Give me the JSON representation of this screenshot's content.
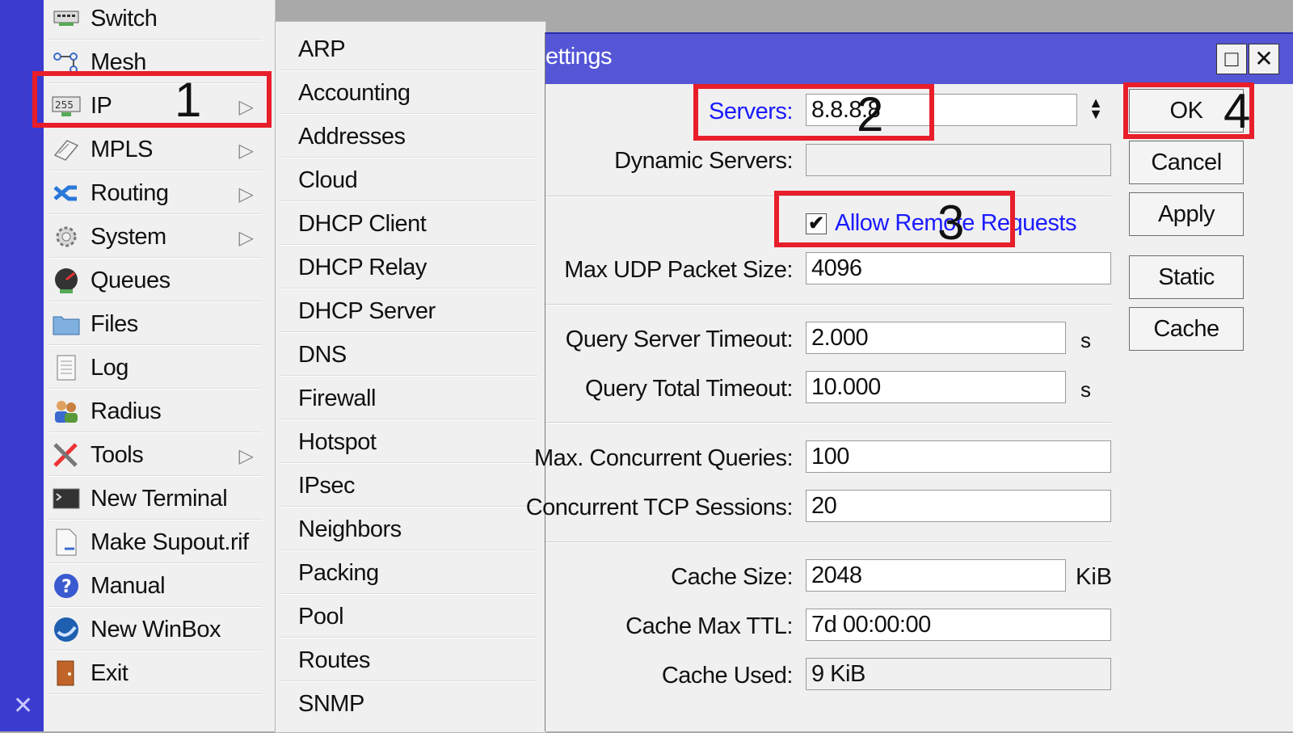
{
  "main_menu": {
    "items": [
      {
        "label": "Switch",
        "icon": "switch-icon",
        "submenu": false
      },
      {
        "label": "Mesh",
        "icon": "mesh-icon",
        "submenu": false
      },
      {
        "label": "IP",
        "icon": "ip-icon",
        "submenu": true
      },
      {
        "label": "MPLS",
        "icon": "mpls-icon",
        "submenu": true
      },
      {
        "label": "Routing",
        "icon": "routing-icon",
        "submenu": true
      },
      {
        "label": "System",
        "icon": "gear-icon",
        "submenu": true
      },
      {
        "label": "Queues",
        "icon": "queues-icon",
        "submenu": false
      },
      {
        "label": "Files",
        "icon": "folder-icon",
        "submenu": false
      },
      {
        "label": "Log",
        "icon": "log-icon",
        "submenu": false
      },
      {
        "label": "Radius",
        "icon": "users-icon",
        "submenu": false
      },
      {
        "label": "Tools",
        "icon": "tools-icon",
        "submenu": true
      },
      {
        "label": "New Terminal",
        "icon": "terminal-icon",
        "submenu": false
      },
      {
        "label": "Make Supout.rif",
        "icon": "document-icon",
        "submenu": false
      },
      {
        "label": "Manual",
        "icon": "help-icon",
        "submenu": false
      },
      {
        "label": "New WinBox",
        "icon": "winbox-icon",
        "submenu": false
      },
      {
        "label": "Exit",
        "icon": "exit-icon",
        "submenu": false
      }
    ],
    "ip_badge": "255",
    "close_glyph": "✕"
  },
  "ip_submenu": {
    "items": [
      "ARP",
      "Accounting",
      "Addresses",
      "Cloud",
      "DHCP Client",
      "DHCP Relay",
      "DHCP Server",
      "DNS",
      "Firewall",
      "Hotspot",
      "IPsec",
      "Neighbors",
      "Packing",
      "Pool",
      "Routes",
      "SNMP"
    ]
  },
  "dialog": {
    "title": "ettings",
    "maximize_glyph": "□",
    "close_glyph": "✕",
    "fields": {
      "servers": {
        "label": "Servers:",
        "value": "8.8.8.8"
      },
      "dynamic_servers": {
        "label": "Dynamic Servers:",
        "value": ""
      },
      "allow_remote": {
        "label": "Allow Remote Requests",
        "checked": true,
        "check_glyph": "✔"
      },
      "max_udp": {
        "label": "Max UDP Packet Size:",
        "value": "4096"
      },
      "query_server_timeout": {
        "label": "Query Server Timeout:",
        "value": "2.000",
        "unit": "s"
      },
      "query_total_timeout": {
        "label": "Query Total Timeout:",
        "value": "10.000",
        "unit": "s"
      },
      "max_concurrent_queries": {
        "label": "Max. Concurrent Queries:",
        "value": "100"
      },
      "concurrent_tcp": {
        "label": "Concurrent TCP Sessions:",
        "value": "20"
      },
      "cache_size": {
        "label": "Cache Size:",
        "value": "2048",
        "unit": "KiB"
      },
      "cache_max_ttl": {
        "label": "Cache Max TTL:",
        "value": "7d 00:00:00"
      },
      "cache_used": {
        "label": "Cache Used:",
        "value": "9 KiB"
      }
    },
    "buttons": {
      "ok": "OK",
      "cancel": "Cancel",
      "apply": "Apply",
      "static": "Static",
      "cache": "Cache"
    }
  },
  "annotations": {
    "step1": "1",
    "step2": "2",
    "step3": "3",
    "step4": "4",
    "highlight_color": "#e81e2a"
  }
}
